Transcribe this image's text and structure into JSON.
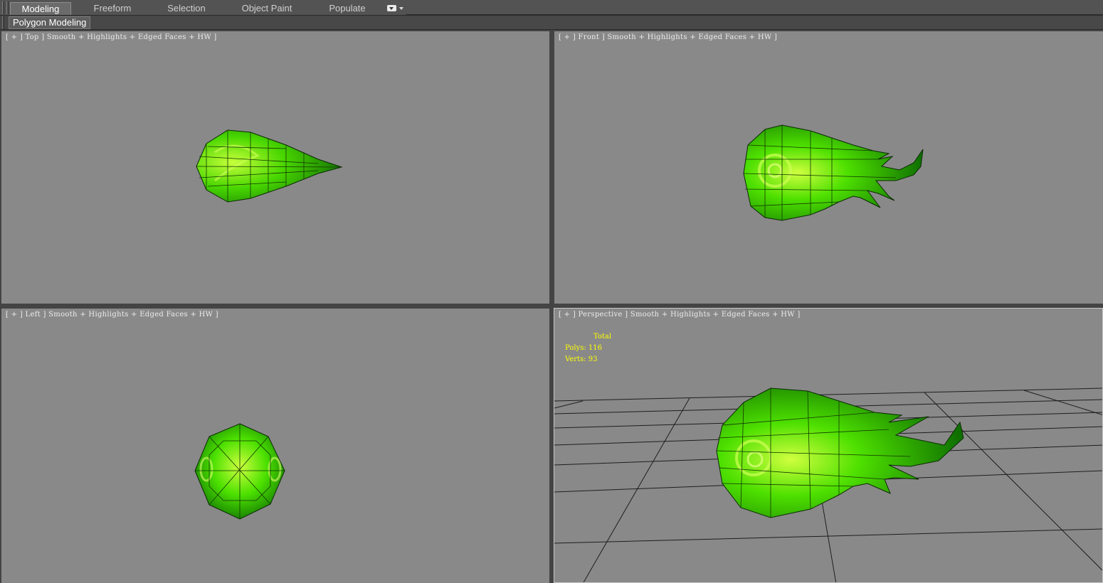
{
  "ribbon": {
    "tabs": [
      {
        "label": "Modeling",
        "active": true
      },
      {
        "label": "Freeform",
        "active": false
      },
      {
        "label": "Selection",
        "active": false
      },
      {
        "label": "Object Paint",
        "active": false
      },
      {
        "label": "Populate",
        "active": false
      }
    ],
    "dropdown_icon": "ribbon-options-dropdown-icon"
  },
  "subribbon": {
    "active_panel": "Polygon Modeling"
  },
  "viewports": {
    "top": {
      "label": "[ + ] Top ] Smooth + Highlights + Edged Faces + HW ]"
    },
    "front": {
      "label": "[ + ] Front ] Smooth + Highlights + Edged Faces + HW ]"
    },
    "left": {
      "label": "[ + ] Left ] Smooth + Highlights + Edged Faces + HW ]"
    },
    "perspective": {
      "label": "[ + ] Perspective ] Smooth + Highlights + Edged Faces + HW ]",
      "stats": {
        "title": "Total",
        "polys_label": "Polys:",
        "polys_value": "116",
        "verts_label": "Verts:",
        "verts_value": "93"
      }
    }
  },
  "colors": {
    "viewport_bg": "#898989",
    "model_green": "#3fd400",
    "model_highlight": "#b8ff30",
    "stats_text": "#ffff00",
    "active_viewport_border": "#c8c8c8"
  }
}
